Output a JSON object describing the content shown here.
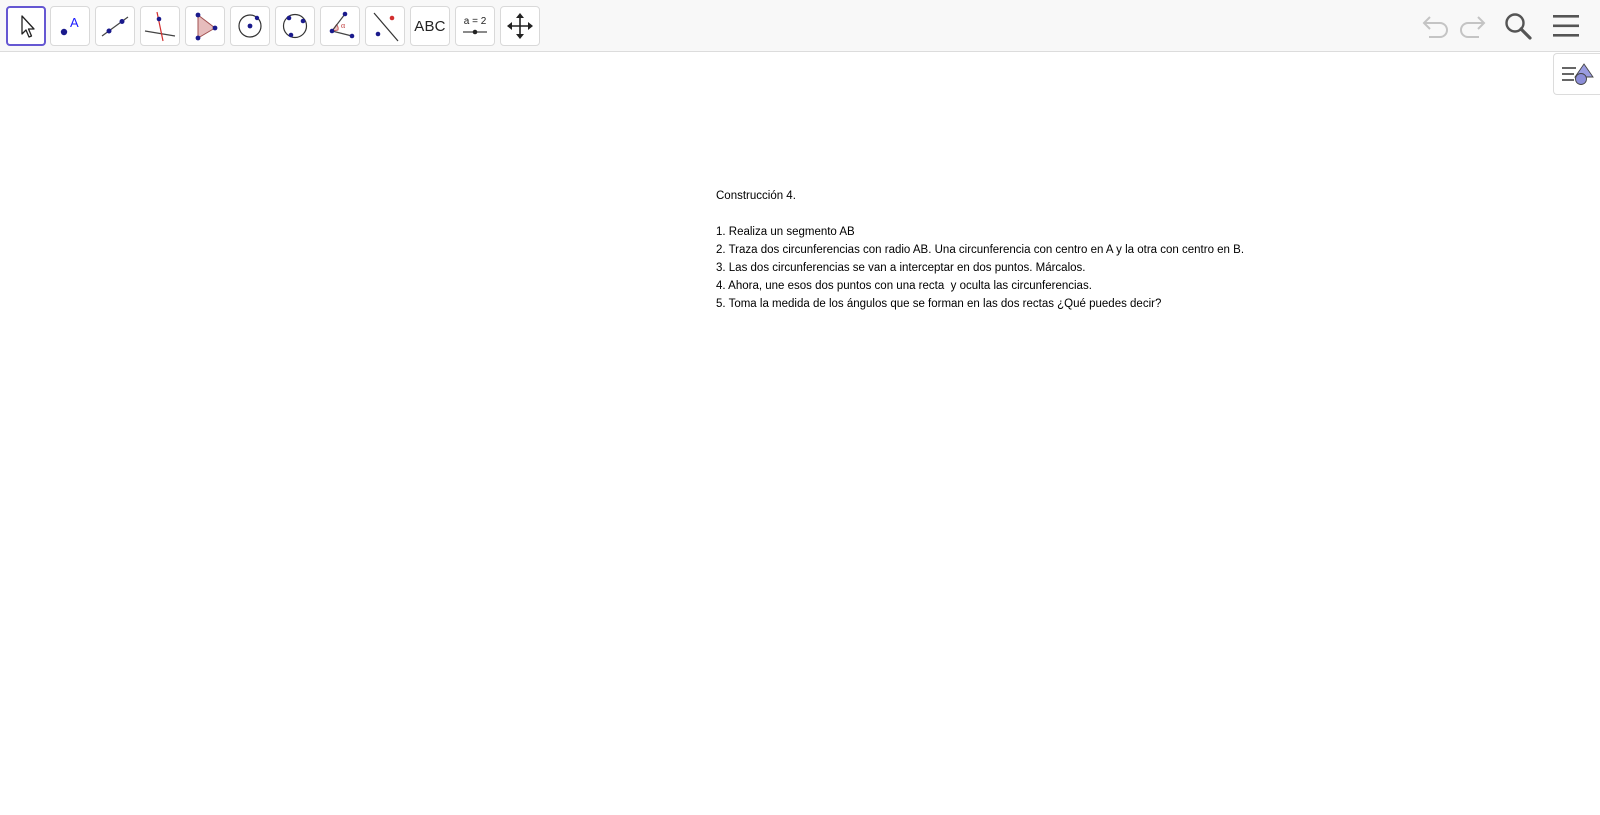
{
  "toolbar": {
    "tools": [
      {
        "name": "move-tool",
        "icon": "arrow-cursor-icon"
      },
      {
        "name": "point-tool",
        "icon": "point-icon",
        "label": "A"
      },
      {
        "name": "segment-tool",
        "icon": "segment-icon"
      },
      {
        "name": "perpendicular-line-tool",
        "icon": "perpendicular-line-icon"
      },
      {
        "name": "polygon-tool",
        "icon": "polygon-icon"
      },
      {
        "name": "circle-center-point-tool",
        "icon": "circle-center-icon"
      },
      {
        "name": "circle-three-points-tool",
        "icon": "circle-three-points-icon"
      },
      {
        "name": "angle-tool",
        "icon": "angle-icon",
        "label": "α"
      },
      {
        "name": "reflect-tool",
        "icon": "reflect-about-line-icon"
      },
      {
        "name": "text-tool",
        "icon": "text-icon",
        "label": "ABC"
      },
      {
        "name": "slider-tool",
        "icon": "slider-icon",
        "label": "a = 2"
      },
      {
        "name": "move-graphics-view-tool",
        "icon": "move-arrows-icon"
      }
    ],
    "undo_icon": "undo-icon",
    "redo_icon": "redo-icon",
    "search_icon": "search-icon",
    "menu_icon": "hamburger-menu-icon"
  },
  "side_panel": {
    "icon": "algebra-view-toggle-icon"
  },
  "content": {
    "title": "Construcción 4.",
    "steps": [
      "1. Realiza un segmento AB",
      "2. Traza dos circunferencias con radio AB. Una circunferencia con centro en A y la otra con centro en B.",
      "3. Las dos circunferencias se van a interceptar en dos puntos. Márcalos.",
      "4. Ahora, une esos dos puntos con una recta  y oculta las circunferencias.",
      "5. Toma la medida de los ángulos que se forman en las dos rectas ¿Qué puedes decir?"
    ]
  },
  "colors": {
    "accent": "#6557d2",
    "point": "#1a1a8c",
    "red": "#d22f2f"
  }
}
